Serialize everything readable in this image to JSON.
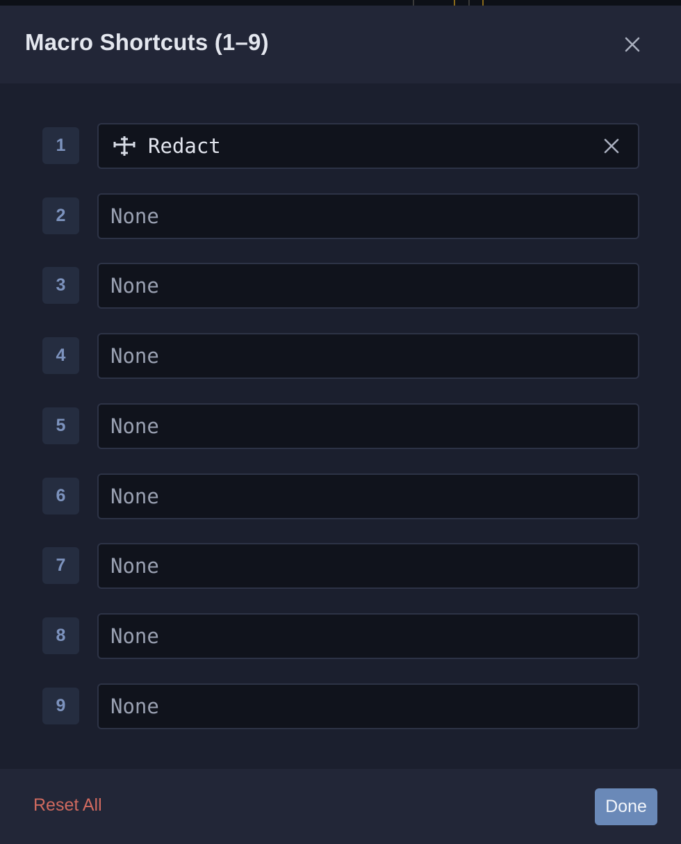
{
  "dialog": {
    "title": "Macro Shortcuts (1–9)"
  },
  "slots": [
    {
      "number": "1",
      "label": "Redact",
      "icon": "move-crosshair-icon",
      "assigned": true
    },
    {
      "number": "2",
      "label": "None",
      "assigned": false
    },
    {
      "number": "3",
      "label": "None",
      "assigned": false
    },
    {
      "number": "4",
      "label": "None",
      "assigned": false
    },
    {
      "number": "5",
      "label": "None",
      "assigned": false
    },
    {
      "number": "6",
      "label": "None",
      "assigned": false
    },
    {
      "number": "7",
      "label": "None",
      "assigned": false
    },
    {
      "number": "8",
      "label": "None",
      "assigned": false
    },
    {
      "number": "9",
      "label": "None",
      "assigned": false
    }
  ],
  "footer": {
    "reset_label": "Reset All",
    "done_label": "Done"
  },
  "colors": {
    "reset_text": "#d06a5f",
    "done_button": "#6a89b8",
    "badge_text": "#7d93be"
  }
}
